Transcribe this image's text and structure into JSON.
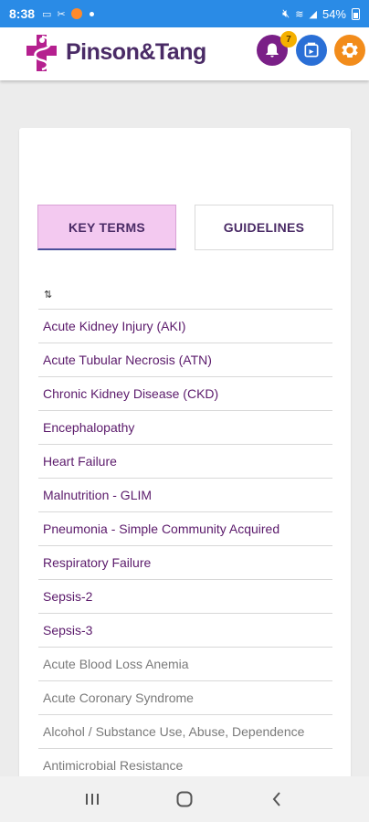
{
  "status_bar": {
    "time": "8:38",
    "battery": "54%",
    "icons": [
      "message-icon",
      "tools-icon",
      "notification-dot",
      "mute-icon",
      "wifi-icon",
      "signal-icon"
    ]
  },
  "header": {
    "brand": "Pinson&Tang",
    "notification_count": "7",
    "icons": [
      "bell-icon",
      "inbox-icon",
      "gear-icon"
    ],
    "colors": {
      "bell": "#7a1f87",
      "inbox": "#2a6fd6",
      "gear": "#f28c1b",
      "brand": "#4a2b66"
    }
  },
  "tabs": [
    {
      "label": "KEY TERMS",
      "selected": true
    },
    {
      "label": "GUIDELINES",
      "selected": false
    }
  ],
  "sort_icon": "sort-arrows-icon",
  "terms": [
    {
      "label": "Acute Kidney Injury (AKI)",
      "active": true
    },
    {
      "label": "Acute Tubular Necrosis (ATN)",
      "active": true
    },
    {
      "label": "Chronic Kidney Disease (CKD)",
      "active": true
    },
    {
      "label": "Encephalopathy",
      "active": true
    },
    {
      "label": "Heart Failure",
      "active": true
    },
    {
      "label": "Malnutrition - GLIM",
      "active": true
    },
    {
      "label": "Pneumonia - Simple Community Acquired",
      "active": true
    },
    {
      "label": "Respiratory Failure",
      "active": true
    },
    {
      "label": "Sepsis-2",
      "active": true
    },
    {
      "label": "Sepsis-3",
      "active": true
    },
    {
      "label": "Acute Blood Loss Anemia",
      "active": false
    },
    {
      "label": "Acute Coronary Syndrome",
      "active": false
    },
    {
      "label": "Alcohol / Substance Use, Abuse, Dependence",
      "active": false
    },
    {
      "label": "Antimicrobial Resistance",
      "active": false
    }
  ],
  "nav": [
    "recent-apps-icon",
    "home-icon",
    "back-icon"
  ]
}
